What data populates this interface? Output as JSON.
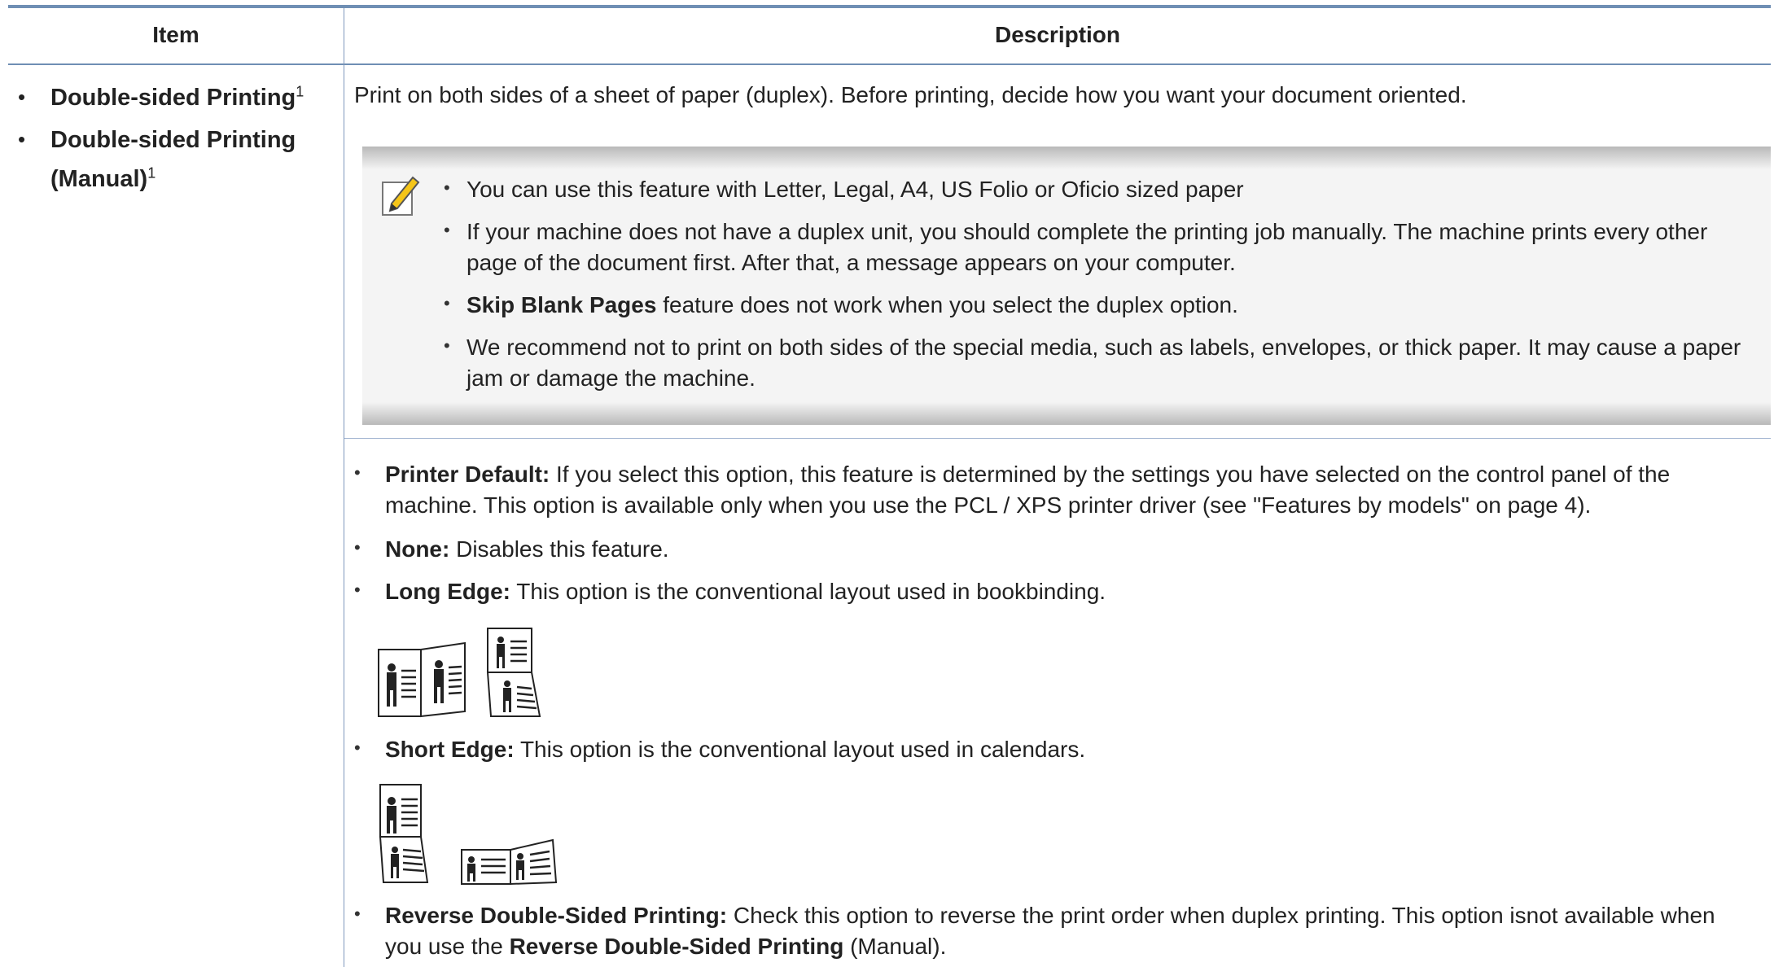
{
  "header": {
    "item": "Item",
    "description": "Description"
  },
  "item": {
    "line1": "Double-sided Printing",
    "line2a": "Double-sided Printing",
    "line2b": "(Manual)",
    "sup": "1"
  },
  "intro": "Print on both sides of a sheet of paper (duplex). Before printing, decide how you want your document oriented.",
  "note": {
    "icon": "note-pencil-icon",
    "b1": "You can use this feature with Letter, Legal, A4, US Folio or Oficio sized paper",
    "b2_l1": "If your machine does not have a duplex unit, you should complete the printing job manually. The machine prints every other",
    "b2_l2": "page of the document first. After that, a message appears on your computer.",
    "b3_bold": "Skip Blank Pages",
    "b3_rest": " feature does not work when you select the duplex option.",
    "b4_l1": "We recommend not to print on both sides of the special media, such as labels, envelopes, or thick paper. It may cause a paper",
    "b4_l2": "jam or damage the machine."
  },
  "options": {
    "pd_bold": "Printer Default:",
    "pd_l1": " If you select this option, this feature is determined by the settings you have selected on the control panel of the",
    "pd_l2": "machine. This option is available only when you use the PCL / XPS printer driver (see \"Features by models\" on page 4).",
    "none_bold": "None:",
    "none_rest": " Disables this feature.",
    "le_bold": "Long Edge:",
    "le_rest": " This option is the conventional layout used in bookbinding.",
    "se_bold": "Short Edge:",
    "se_rest": " This option is the conventional layout used in calendars.",
    "rd_bold": "Reverse Double-Sided Printing:",
    "rd_l1": " Check this option to reverse the print order when duplex printing. This option isnot available when",
    "rd_l2a": "you use the ",
    "rd_l2b": "Reverse Double-Sided Printing",
    "rd_l2c": " (Manual)."
  },
  "figures": {
    "long_edge": "long-edge-binding-illustration",
    "short_edge": "short-edge-binding-illustration"
  },
  "colors": {
    "rule": "#6f8fb4",
    "note_bg": "#f4f4f4"
  }
}
